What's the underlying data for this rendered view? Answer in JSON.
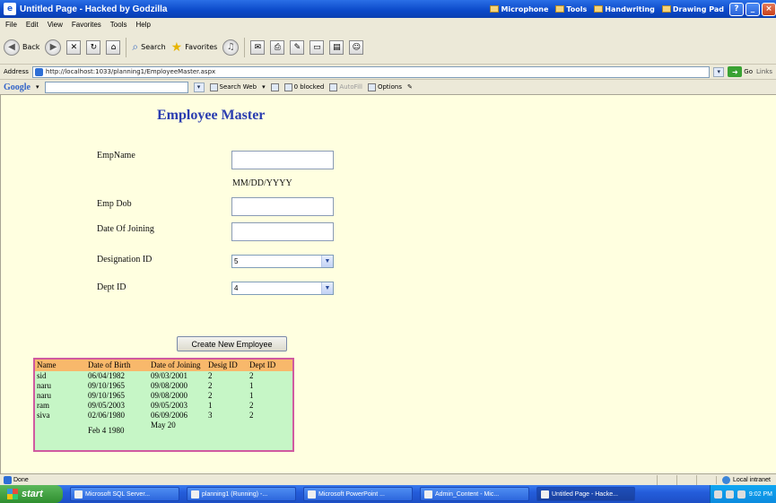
{
  "window": {
    "title": "Untitled Page - Hacked by Godzilla",
    "tray_items": [
      "Microphone",
      "Tools",
      "Handwriting",
      "Drawing Pad"
    ]
  },
  "menu": [
    "File",
    "Edit",
    "View",
    "Favorites",
    "Tools",
    "Help"
  ],
  "toolbar": {
    "back": "Back",
    "search": "Search",
    "favorites": "Favorites"
  },
  "address": {
    "label": "Address",
    "url": "http://localhost:1033/planning1/EmployeeMaster.aspx",
    "go": "Go",
    "links": "Links"
  },
  "google": {
    "logo": "Google",
    "search_web": "Search Web",
    "blocked": "0 blocked",
    "autofill": "AutoFill",
    "options": "Options"
  },
  "page": {
    "title": "Employee Master",
    "labels": {
      "emp_name": "EmpName",
      "emp_dob": "Emp Dob",
      "date_of_joining": "Date Of Joining",
      "designation_id": "Designation ID",
      "dept_id": "Dept ID"
    },
    "date_hint": "MM/DD/YYYY",
    "fields": {
      "emp_name": "",
      "emp_dob": "",
      "date_of_joining": ""
    },
    "designation_selected": "5",
    "dept_selected": "4",
    "create_button": "Create New Employee"
  },
  "grid": {
    "headers": [
      "Name",
      "Date of Birth",
      "Date of Joining",
      "Desig ID",
      "Dept ID"
    ],
    "rows": [
      [
        "sid",
        "06/04/1982",
        "09/03/2001",
        "2",
        "2"
      ],
      [
        "naru",
        "09/10/1965",
        "09/08/2000",
        "2",
        "1"
      ],
      [
        "naru",
        "09/10/1965",
        "09/08/2000",
        "2",
        "1"
      ],
      [
        "ram",
        "09/05/2003",
        "09/05/2003",
        "1",
        "2"
      ],
      [
        "siva",
        "02/06/1980",
        "06/09/2006",
        "3",
        "2"
      ],
      [
        "",
        "Feb 4 1980",
        "May 20",
        "",
        ""
      ]
    ]
  },
  "status": {
    "left": "Done",
    "zone": "Local intranet"
  },
  "taskbar": {
    "start": "start",
    "tasks": [
      "Microsoft SQL Server...",
      "planning1 (Running) -...",
      "Microsoft PowerPoint ...",
      "Admin_Content - Mic...",
      "Untitled Page - Hacke..."
    ],
    "clock": "9:02 PM"
  }
}
